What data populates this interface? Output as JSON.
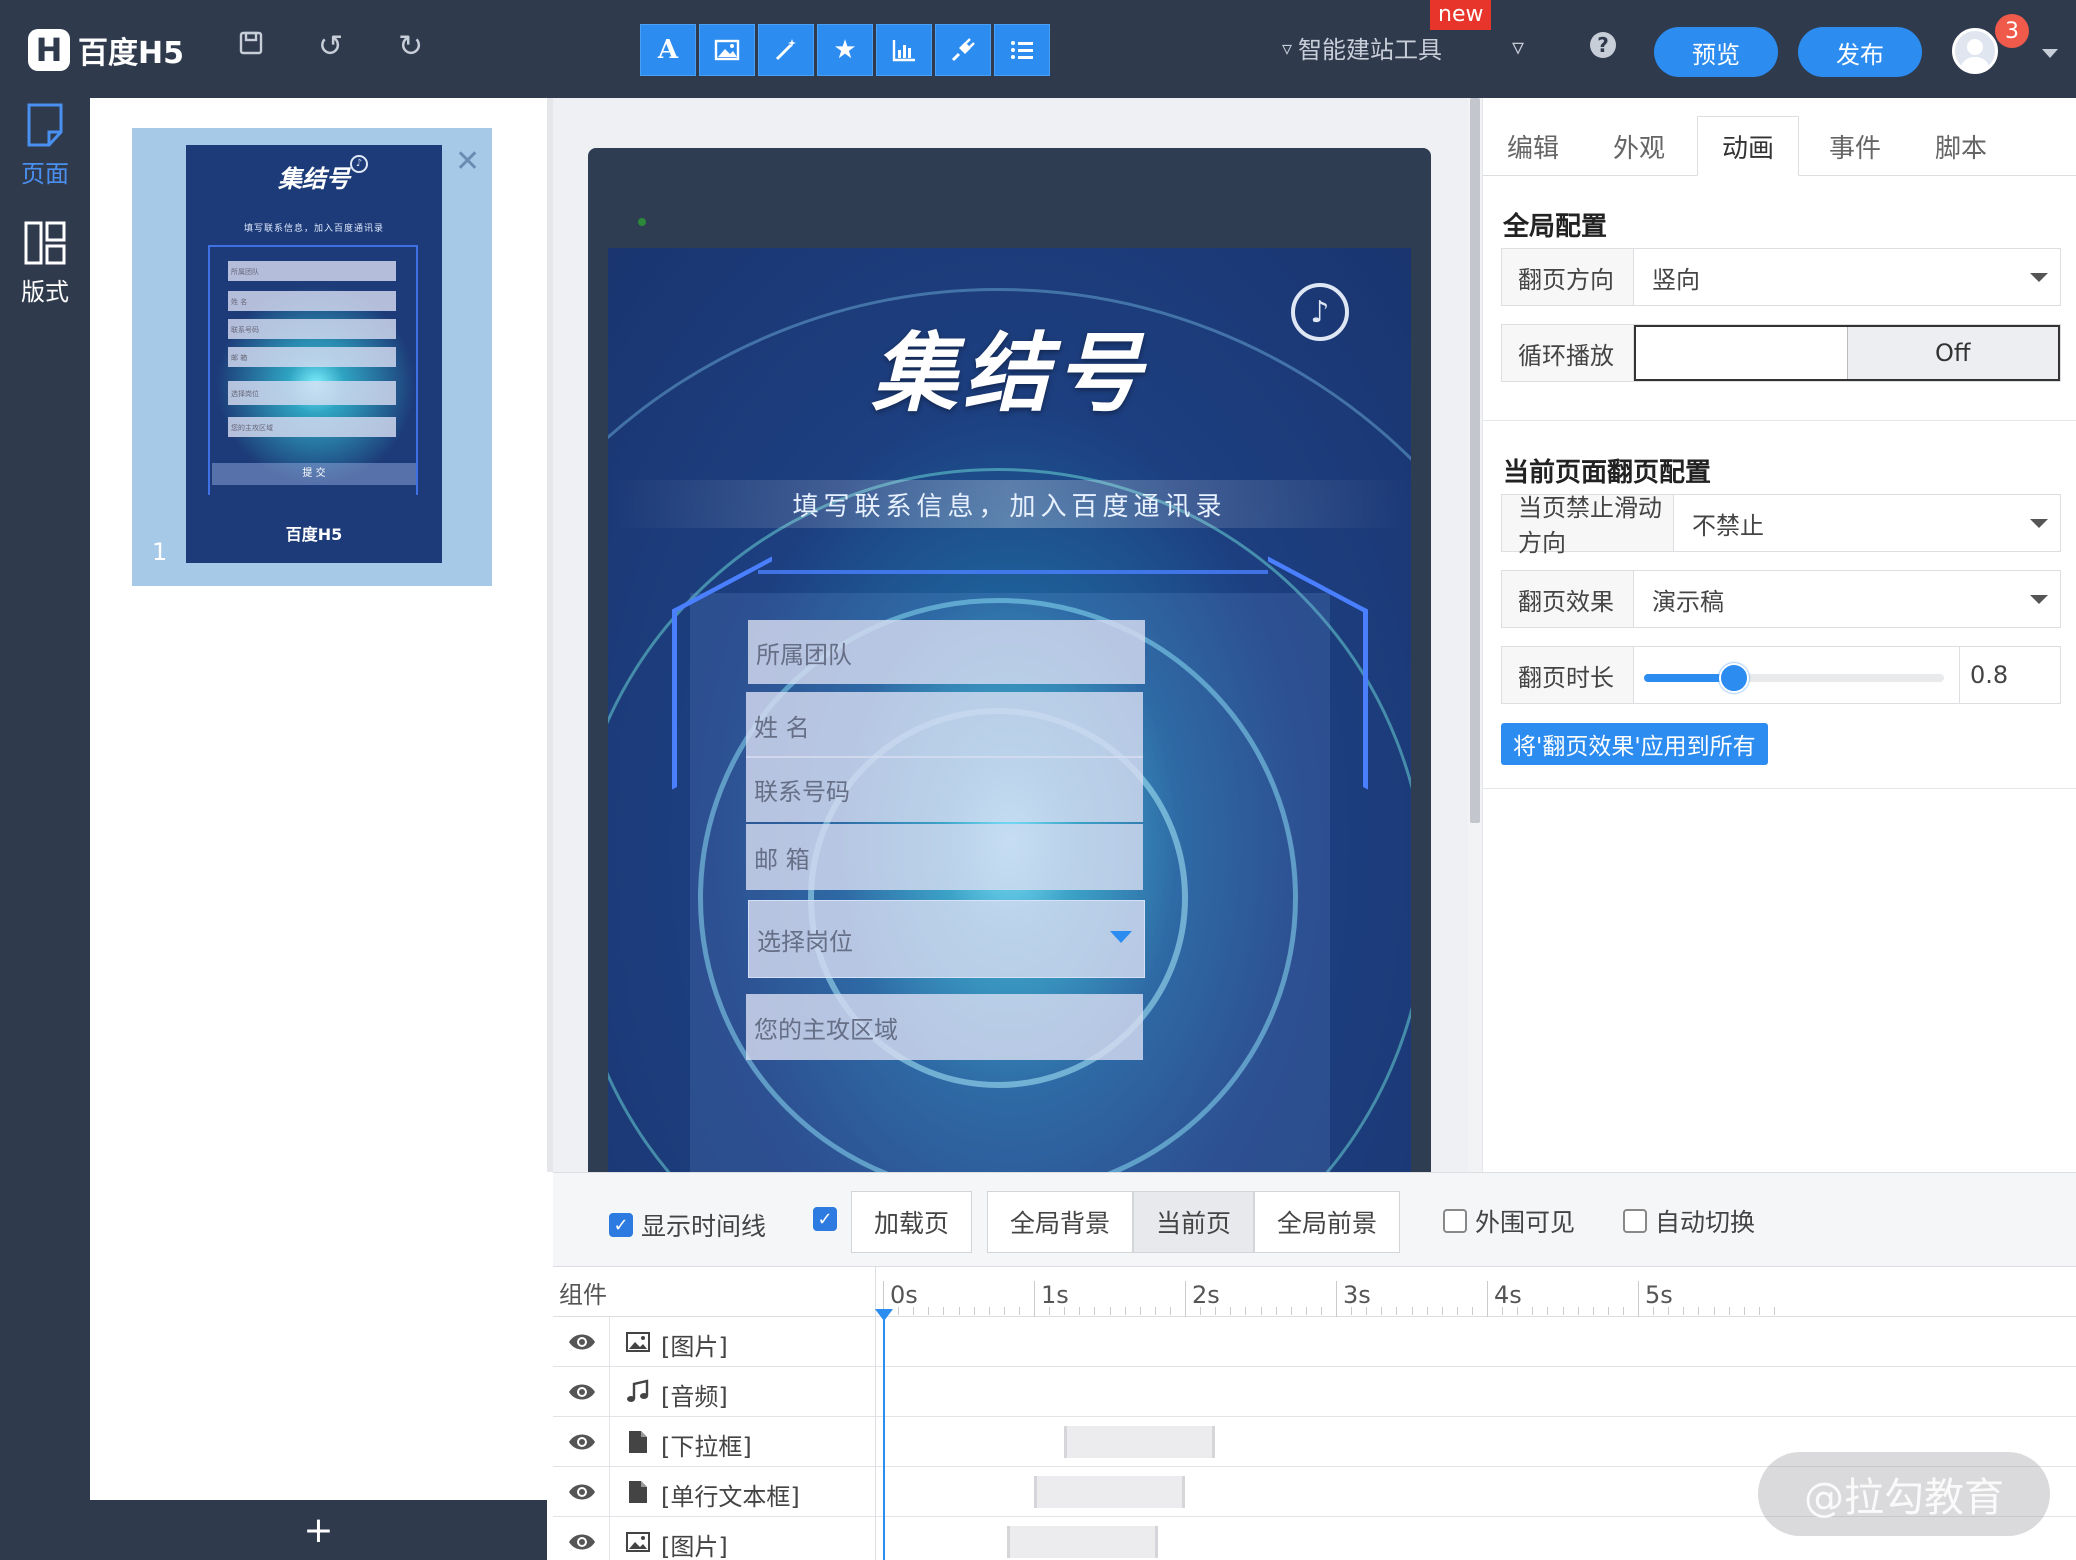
{
  "topbar": {
    "logo_text": "百度H5",
    "logo_mark": "H",
    "ai_tool_label": "智能建站工具",
    "new_badge": "new",
    "preview_label": "预览",
    "publish_label": "发布",
    "notification_count": "3",
    "toolbar_icons": [
      "text-icon",
      "image-icon",
      "magic-wand-icon",
      "star-icon",
      "chart-icon",
      "plugin-icon",
      "list-icon"
    ],
    "text_tool_glyph": "A"
  },
  "leftnav": {
    "items": [
      {
        "label": "页面",
        "icon": "page-icon"
      },
      {
        "label": "版式",
        "icon": "layout-icon"
      }
    ]
  },
  "pagelist": {
    "pages": [
      {
        "number": "1"
      }
    ],
    "add_label": "+"
  },
  "stage": {
    "title": "集结号",
    "subtitle": "填写联系信息，加入百度通讯录",
    "fields": [
      {
        "placeholder": "所属团队",
        "type": "text"
      },
      {
        "placeholder": "姓 名",
        "type": "text"
      },
      {
        "placeholder": "联系号码",
        "type": "text"
      },
      {
        "placeholder": "邮 箱",
        "type": "text"
      },
      {
        "placeholder": "选择岗位",
        "type": "select"
      },
      {
        "placeholder": "您的主攻区域",
        "type": "text"
      }
    ]
  },
  "thumbnail": {
    "title": "集结号",
    "subtitle": "填写联系信息，加入百度通讯录",
    "field_labels": [
      "所属团队",
      "姓 名",
      "联系号码",
      "邮 箱",
      "选择岗位",
      "您的主攻区域"
    ],
    "submit_label": "提 交",
    "footer_logo": "百度H5"
  },
  "rightpanel": {
    "tabs": [
      "编辑",
      "外观",
      "动画",
      "事件",
      "脚本"
    ],
    "active_tab": "动画",
    "global_config_title": "全局配置",
    "flip_direction": {
      "label": "翻页方向",
      "value": "竖向"
    },
    "loop_play": {
      "label": "循环播放",
      "on_label": "",
      "off_label": "Off"
    },
    "current_page_title": "当前页面翻页配置",
    "disable_swipe": {
      "label": "当页禁止滑动方向",
      "value": "不禁止"
    },
    "flip_effect": {
      "label": "翻页效果",
      "value": "演示稿"
    },
    "flip_duration": {
      "label": "翻页时长",
      "value": "0.8",
      "fraction": 0.3
    },
    "apply_all_label": "将'翻页效果'应用到所有"
  },
  "timeline": {
    "show_timeline": {
      "label": "显示时间线",
      "checked": true
    },
    "second_checkbox": {
      "label": "",
      "checked": true
    },
    "segments": [
      "加载页",
      "全局背景",
      "当前页",
      "全局前景"
    ],
    "active_segment": "当前页",
    "outside_visible": {
      "label": "外围可见",
      "checked": false
    },
    "auto_switch": {
      "label": "自动切换",
      "checked": false
    },
    "component_header": "组件",
    "ticks": [
      "0s",
      "1s",
      "2s",
      "3s",
      "4s",
      "5s"
    ],
    "rows": [
      {
        "label": "[图片]",
        "icon": "image-icon",
        "bar_start_s": null,
        "bar_end_s": null
      },
      {
        "label": "[音频]",
        "icon": "music-icon",
        "bar_start_s": null,
        "bar_end_s": null
      },
      {
        "label": "[下拉框]",
        "icon": "file-icon",
        "bar_start_s": 1.2,
        "bar_end_s": 2.2
      },
      {
        "label": "[单行文本框]",
        "icon": "file-icon",
        "bar_start_s": 1.0,
        "bar_end_s": 2.0
      },
      {
        "label": "[图片]",
        "icon": "image-icon",
        "bar_start_s": 0.82,
        "bar_end_s": 1.82
      }
    ]
  },
  "watermark": "@拉勾教育",
  "colors": {
    "topbar_bg": "#2f3a4d",
    "accent": "#2d8cf0",
    "badge_red": "#e8352b"
  }
}
